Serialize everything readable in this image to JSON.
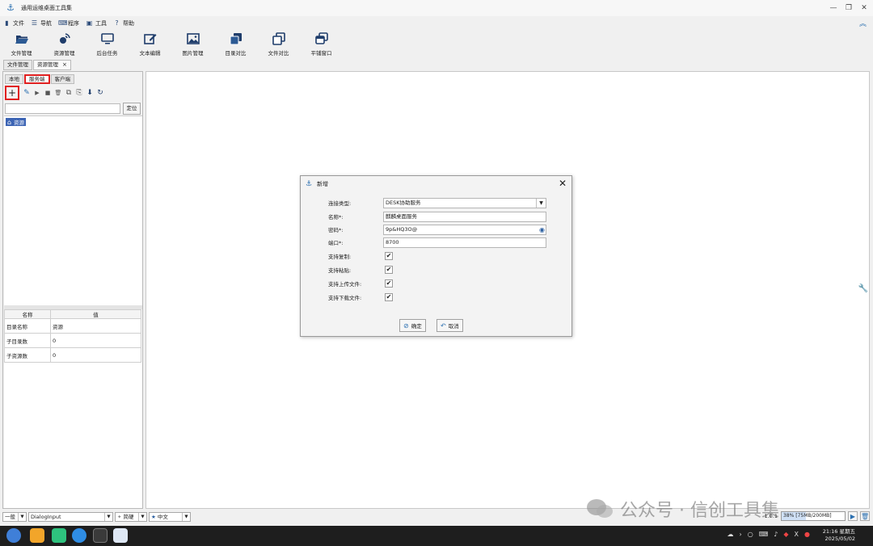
{
  "window": {
    "title": "通用运维桌面工具集"
  },
  "menu": [
    {
      "label": "文件",
      "icon": "file-icon"
    },
    {
      "label": "导航",
      "icon": "list-icon"
    },
    {
      "label": "程序",
      "icon": "keyboard-icon"
    },
    {
      "label": "工具",
      "icon": "toolbox-icon"
    },
    {
      "label": "帮助",
      "icon": "help-icon"
    }
  ],
  "toolbar": [
    {
      "label": "文件管理",
      "icon": "folder-open-icon"
    },
    {
      "label": "资源管理",
      "icon": "satellite-icon"
    },
    {
      "label": "后台任务",
      "icon": "monitor-icon"
    },
    {
      "label": "文本编辑",
      "icon": "edit-icon"
    },
    {
      "label": "图片管理",
      "icon": "image-icon"
    },
    {
      "label": "目录对比",
      "icon": "copy-folder-icon"
    },
    {
      "label": "文件对比",
      "icon": "copy-icon"
    },
    {
      "label": "平铺窗口",
      "icon": "windows-icon"
    }
  ],
  "doc_tabs": [
    {
      "label": "文件管理"
    },
    {
      "label": "资源管理",
      "close": "×"
    }
  ],
  "sub_tabs": [
    "本地",
    "服务端",
    "客户端"
  ],
  "left_toolbar": {
    "add": "+",
    "edit": "✎",
    "play": "▶",
    "stop": "■",
    "delete": "🗑",
    "copy": "⧉",
    "paste": "⎘",
    "export": "⬇",
    "refresh": "↻"
  },
  "search": {
    "value": "",
    "locate_label": "定位"
  },
  "tree": {
    "root_label": "资源"
  },
  "props": {
    "headers": [
      "名称",
      "值"
    ],
    "rows": [
      [
        "目录名称",
        "资源"
      ],
      [
        "子目录数",
        "0"
      ],
      [
        "子资源数",
        "0"
      ]
    ]
  },
  "dialog": {
    "title": "新增",
    "close": "✕",
    "fields": {
      "conn_type_label": "连接类型:",
      "conn_type_value": "DESK协助服务",
      "name_label": "名称*:",
      "name_value": "麒麟桌面服务",
      "password_label": "密码*:",
      "password_value": "9p&HQ3O@",
      "port_label": "端口*:",
      "port_value": "8700",
      "copy_label": "支持复制:",
      "paste_label": "支持粘贴:",
      "upload_label": "支持上传文件:",
      "download_label": "支持下载文件:"
    },
    "checks": {
      "copy": true,
      "paste": true,
      "upload": true,
      "download": true
    },
    "ok_label": "确定",
    "cancel_label": "取消"
  },
  "status": {
    "level": "一般",
    "module": "DialogInput",
    "input_method": "简硬",
    "lang": "中文",
    "version": "1.0.1",
    "memory": "38% [75MB/200MB]",
    "memory_fraction": 0.38
  },
  "watermark": {
    "text": "公众号 · 信创工具集"
  },
  "clock": {
    "time": "21:16 星期五",
    "date": "2025/05/02"
  },
  "colors": {
    "accent": "#2a6fb0",
    "highlight": "#e02020",
    "selection": "#3c64b4",
    "taskbar": "#1e1e1e"
  }
}
